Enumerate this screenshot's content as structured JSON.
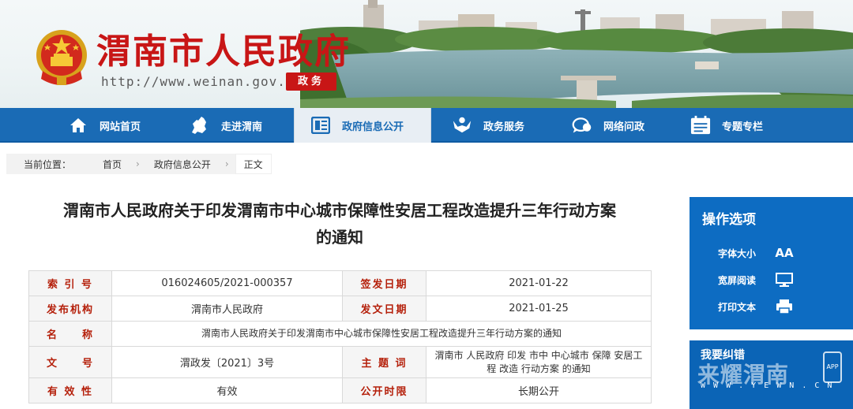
{
  "header": {
    "site_title": "渭南市人民政府",
    "site_url": "http://www.weinan.gov.cn",
    "badge": "政务"
  },
  "nav": {
    "items": [
      {
        "label": "网站首页",
        "icon": "home-icon"
      },
      {
        "label": "走进渭南",
        "icon": "map-icon"
      },
      {
        "label": "政府信息公开",
        "icon": "document-icon",
        "active": true
      },
      {
        "label": "政务服务",
        "icon": "service-icon"
      },
      {
        "label": "网络问政",
        "icon": "chat-icon"
      },
      {
        "label": "专题专栏",
        "icon": "calendar-icon"
      }
    ]
  },
  "breadcrumb": {
    "label": "当前位置：",
    "items": [
      "首页",
      "政府信息公开",
      "正文"
    ]
  },
  "article": {
    "title_line1": "渭南市人民政府关于印发渭南市中心城市保障性安居工程改造提升三年行动方案",
    "title_line2": "的通知"
  },
  "meta": {
    "rows": [
      {
        "k1": "索 引 号",
        "v1": "016024605/2021-000357",
        "k2": "签发日期",
        "v2": "2021-01-22"
      },
      {
        "k1": "发布机构",
        "v1": "渭南市人民政府",
        "k2": "发文日期",
        "v2": "2021-01-25"
      },
      {
        "k1": "名　　称",
        "v1": "渭南市人民政府关于印发渭南市中心城市保障性安居工程改造提升三年行动方案的通知"
      },
      {
        "k1": "文　　号",
        "v1": "渭政发〔2021〕3号",
        "k2": "主 题 词",
        "v2": "渭南市 人民政府 印发 市中 中心城市 保障 安居工程 改造 行动方案 的通知"
      },
      {
        "k1": "有 效 性",
        "v1": "有效",
        "k2": "公开时限",
        "v2": "长期公开"
      }
    ]
  },
  "sidebar": {
    "title": "操作选项",
    "font_size_label": "字体大小",
    "font_size_glyph": "AA",
    "wide_read_label": "宽屏阅读",
    "print_label": "打印文本"
  },
  "promo": {
    "slogan": "我要纠错",
    "brand": "来耀渭南",
    "url": "W W W . Y E W N . C N",
    "app": "APP"
  },
  "colors": {
    "brand_red": "#c81616",
    "nav_blue": "#1a6bb5",
    "panel_blue": "#0d6cc2",
    "key_red": "#b5200b"
  }
}
